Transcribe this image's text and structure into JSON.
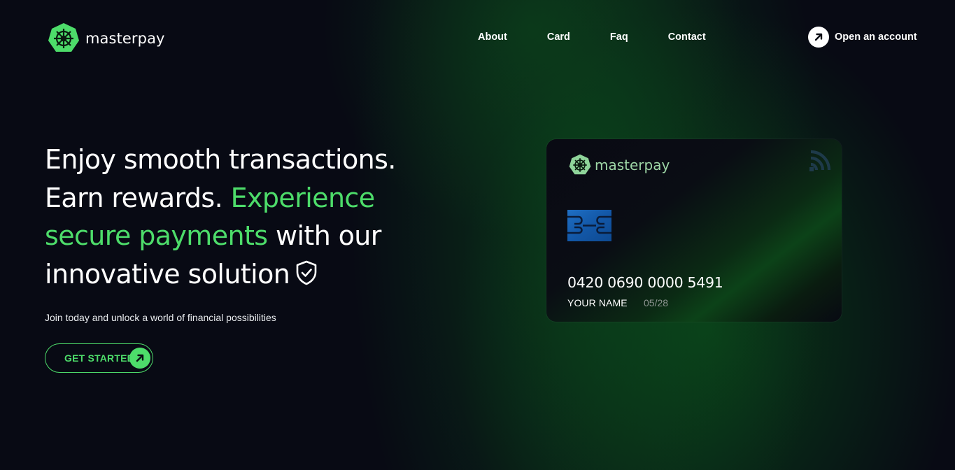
{
  "brand": {
    "name": "masterpay",
    "logo_icon": "ship-wheel-icon",
    "accent_color": "#4ddc6a",
    "background_color": "#080a14"
  },
  "nav": {
    "items": [
      {
        "label": "About"
      },
      {
        "label": "Card"
      },
      {
        "label": "Faq"
      },
      {
        "label": "Contact"
      }
    ]
  },
  "header_cta": {
    "label": "Open an account",
    "icon": "arrow-up-right-icon"
  },
  "hero": {
    "line1": "Enjoy smooth transactions.",
    "line2_white": "Earn rewards. ",
    "line2_green": "Experience",
    "line3_green": "secure payments",
    "line3_white": " with our",
    "line4_white": "innovative solution",
    "title_icon": "shield-check-icon",
    "subtitle": "Join today and unlock a world of financial possibilities",
    "cta_label": "GET STARTED",
    "cta_icon": "arrow-up-right-icon"
  },
  "card": {
    "brand": "masterpay",
    "number": "0420 0690 0000 5491",
    "holder": "YOUR NAME",
    "expiry": "05/28",
    "chip_icon": "card-chip-icon",
    "contactless_icon": "contactless-icon"
  }
}
